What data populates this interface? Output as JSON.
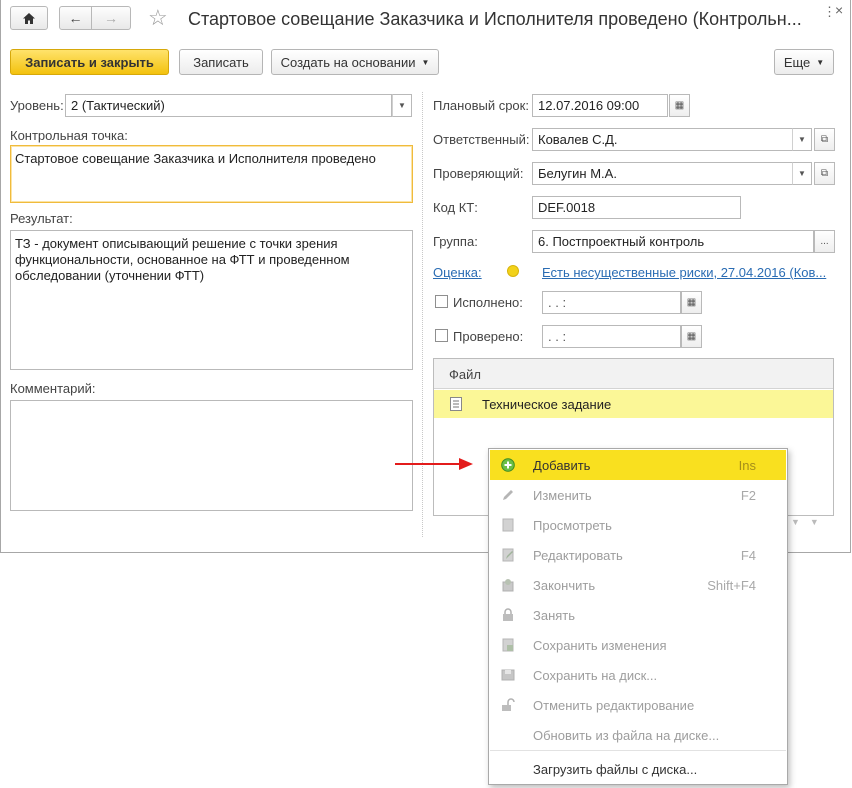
{
  "window": {
    "title": "Стартовое совещание Заказчика и Исполнителя проведено (Контрольн..."
  },
  "toolbar": {
    "save_close_label": "Записать и закрыть",
    "save_label": "Записать",
    "create_based_label": "Создать на основании",
    "more_label": "Еще"
  },
  "form": {
    "level": {
      "label": "Уровень:",
      "value": "2 (Тактический)"
    },
    "checkpoint": {
      "label": "Контрольная точка:",
      "value": "Стартовое совещание Заказчика и Исполнителя проведено"
    },
    "result": {
      "label": "Результат:",
      "value": "ТЗ - документ описывающий решение с точки зрения функциональности, основанное на ФТТ  и проведенном обследовании (уточнении ФТТ)"
    },
    "comment": {
      "label": "Комментарий:",
      "value": ""
    },
    "planned_date": {
      "label": "Плановый срок:",
      "value": "12.07.2016 09:00"
    },
    "responsible": {
      "label": "Ответственный:",
      "value": "Ковалев С.Д."
    },
    "reviewer": {
      "label": "Проверяющий:",
      "value": "Белугин М.А."
    },
    "kt_code": {
      "label": "Код КТ:",
      "value": "DEF.0018"
    },
    "group": {
      "label": "Группа:",
      "value": "6. Постпроектный контроль"
    },
    "assessment": {
      "label": "Оценка:",
      "value": "Есть несущественные риски, 27.04.2016 (Ков...",
      "indicator_color": "#f2d21a"
    },
    "done": {
      "label": "Исполнено:",
      "value": "  .   .        :"
    },
    "checked": {
      "label": "Проверено:",
      "value": "  .   .        :"
    }
  },
  "files_table": {
    "header": "Файл",
    "rows": [
      {
        "name": "Техническое задание"
      }
    ]
  },
  "context_menu": {
    "items": [
      {
        "label": "Добавить",
        "shortcut": "Ins",
        "icon": "add-icon",
        "state": "active"
      },
      {
        "label": "Изменить",
        "shortcut": "F2",
        "icon": "pencil-icon",
        "state": "disabled"
      },
      {
        "label": "Просмотреть",
        "shortcut": "",
        "icon": "view-icon",
        "state": "disabled"
      },
      {
        "label": "Редактировать",
        "shortcut": "F4",
        "icon": "edit-file-icon",
        "state": "disabled"
      },
      {
        "label": "Закончить",
        "shortcut": "Shift+F4",
        "icon": "finish-icon",
        "state": "disabled"
      },
      {
        "label": "Занять",
        "shortcut": "",
        "icon": "lock-icon",
        "state": "disabled"
      },
      {
        "label": "Сохранить изменения",
        "shortcut": "",
        "icon": "save-changes-icon",
        "state": "disabled"
      },
      {
        "label": "Сохранить на диск...",
        "shortcut": "",
        "icon": "save-disk-icon",
        "state": "disabled"
      },
      {
        "label": "Отменить редактирование",
        "shortcut": "",
        "icon": "unlock-icon",
        "state": "disabled"
      },
      {
        "label": "Обновить из файла на диске...",
        "shortcut": "",
        "icon": "",
        "state": "disabled"
      },
      {
        "label": "Загрузить файлы с диска...",
        "shortcut": "",
        "icon": "",
        "state": "enabled"
      }
    ]
  },
  "colors": {
    "accent": "#f3c20e",
    "highlight_row": "#fbf797",
    "menu_active": "#f9e01f",
    "link": "#2a6cb3",
    "arrow": "#e31b1b"
  }
}
